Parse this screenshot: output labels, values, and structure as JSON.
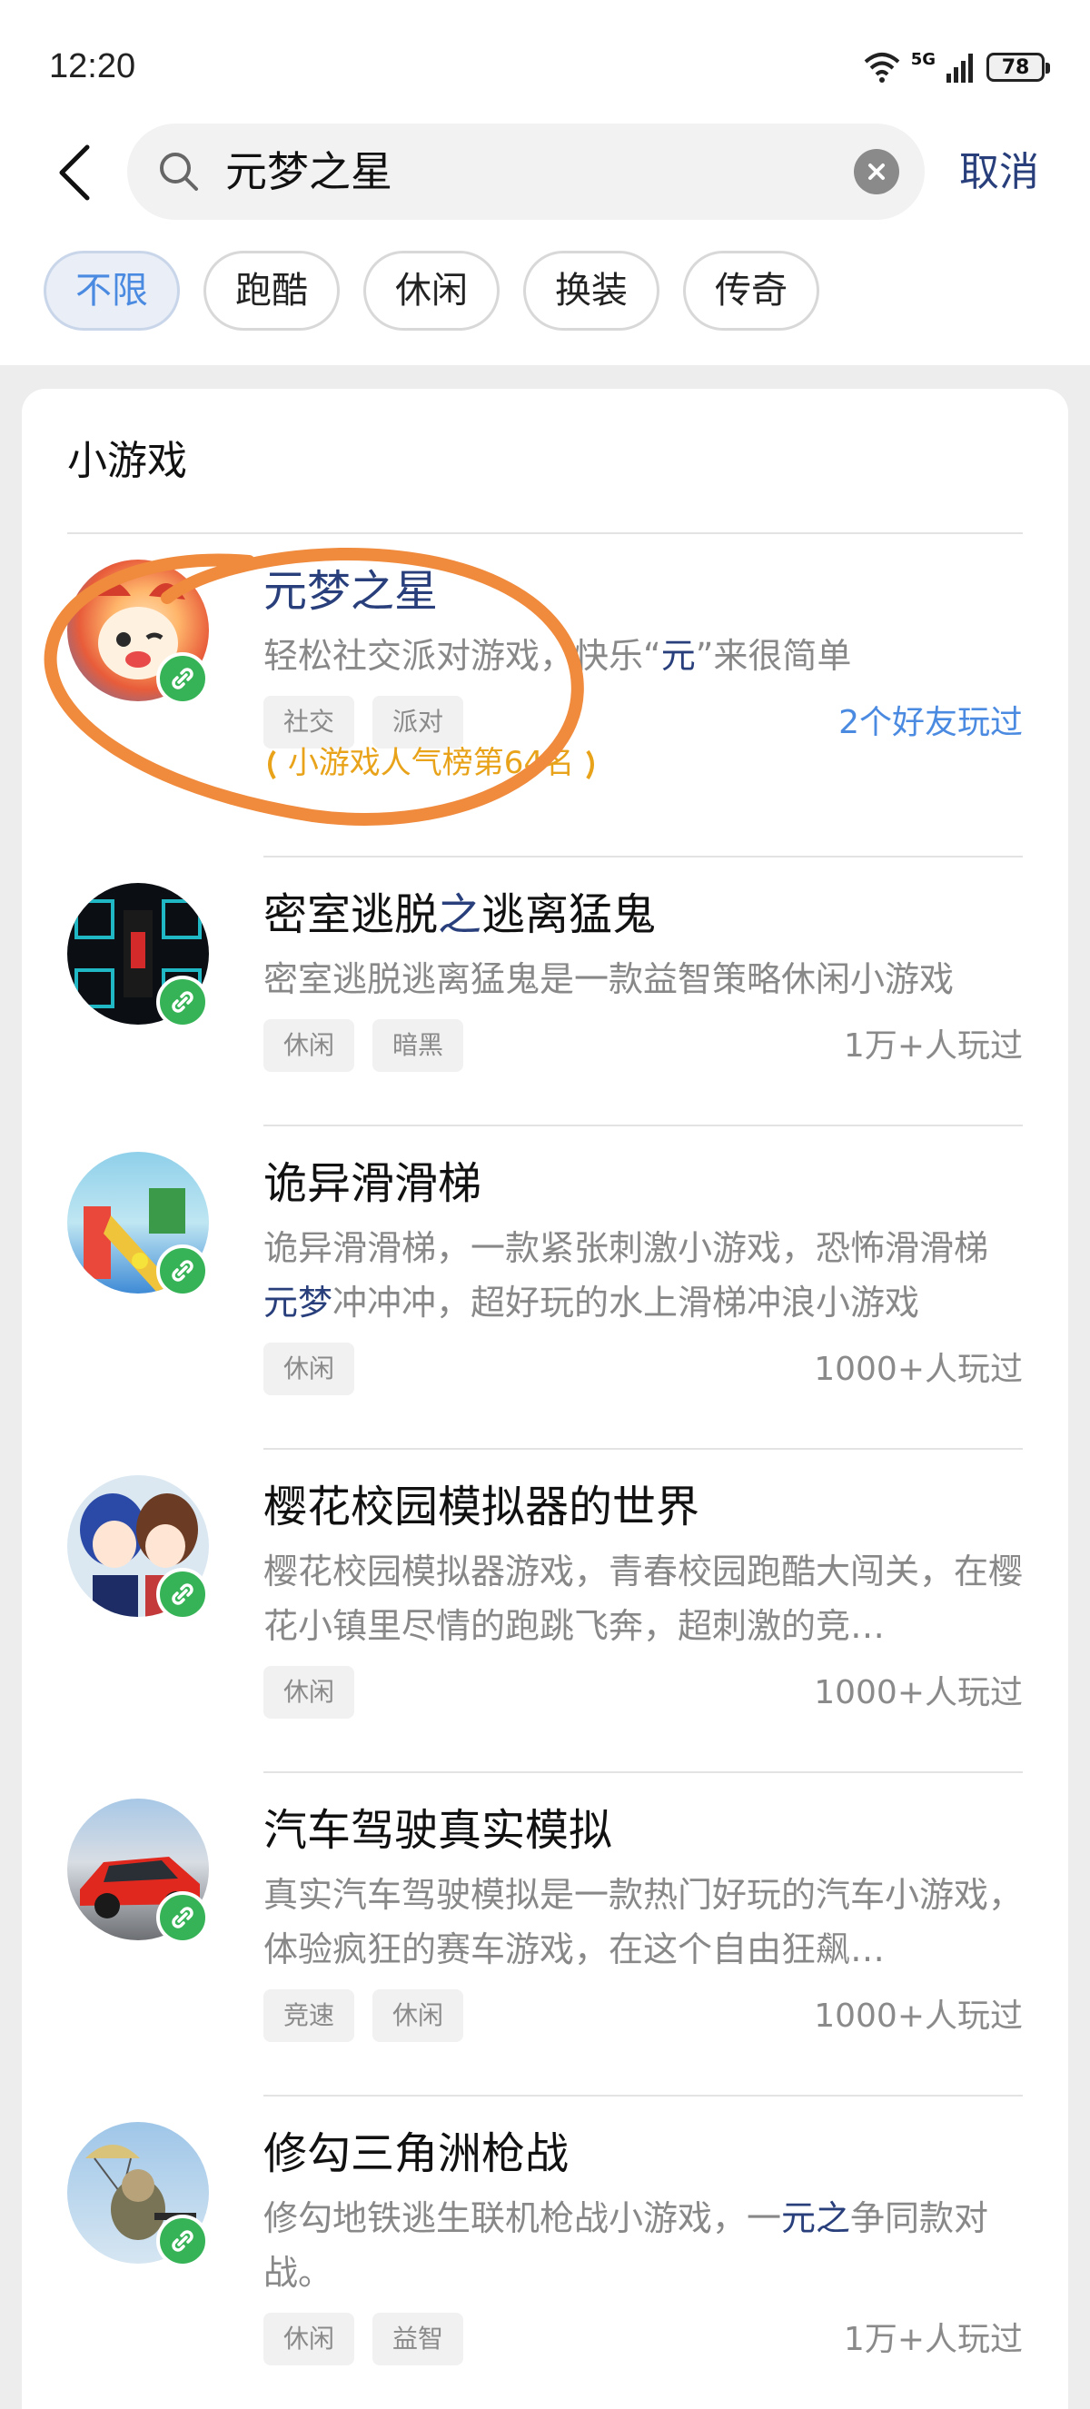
{
  "status": {
    "time": "12:20",
    "network": "5G",
    "battery": "78"
  },
  "search": {
    "query": "元梦之星",
    "cancel": "取消"
  },
  "filters": [
    "不限",
    "跑酷",
    "休闲",
    "换装",
    "传奇"
  ],
  "section": {
    "title": "小游戏"
  },
  "items": [
    {
      "name_parts": [
        "元梦之星",
        "",
        ""
      ],
      "desc_parts": [
        "轻松社交派对游戏，快乐“",
        "元",
        "”来很简单"
      ],
      "tags": [
        "社交",
        "派对"
      ],
      "played": "2个好友玩过",
      "rank": "小游戏人气榜第64名"
    },
    {
      "name_parts": [
        "密室逃脱",
        "之",
        "逃离猛鬼"
      ],
      "desc_parts": [
        "密室逃脱逃离猛鬼是一款益智策略休闲小游戏",
        "",
        ""
      ],
      "tags": [
        "休闲",
        "暗黑"
      ],
      "played": "1万+人玩过"
    },
    {
      "name_parts": [
        "诡异滑滑梯",
        "",
        ""
      ],
      "desc_parts": [
        "诡异滑滑梯，一款紧张刺激小游戏，恐怖滑滑梯",
        "元梦",
        "冲冲冲，超好玩的水上滑梯冲浪小游戏"
      ],
      "tags": [
        "休闲"
      ],
      "played": "1000+人玩过"
    },
    {
      "name_parts": [
        "樱花校园模拟器的世界",
        "",
        ""
      ],
      "desc_parts": [
        "樱花校园模拟器游戏，青春校园跑酷大闯关，在樱花小镇里尽情的跑跳飞奔，超刺激的竞…",
        "",
        ""
      ],
      "tags": [
        "休闲"
      ],
      "played": "1000+人玩过"
    },
    {
      "name_parts": [
        "汽车驾驶真实模拟",
        "",
        ""
      ],
      "desc_parts": [
        "真实汽车驾驶模拟是一款热门好玩的汽车小游戏，体验疯狂的赛车游戏，在这个自由狂飙…",
        "",
        ""
      ],
      "tags": [
        "竞速",
        "休闲"
      ],
      "played": "1000+人玩过"
    },
    {
      "name_parts": [
        "修勾三角洲枪战",
        "",
        ""
      ],
      "desc_parts": [
        "修勾地铁逃生联机枪战小游戏，一",
        "元之",
        "争同款对战。"
      ],
      "tags": [
        "休闲",
        "益智"
      ],
      "played": "1万+人玩过"
    }
  ],
  "colors": {
    "accent": "#283f7c",
    "link_blue": "#4b8ae1",
    "rank_gold": "#e8a31a",
    "annotation": "#f08a3c",
    "mini_badge": "#35b356"
  }
}
